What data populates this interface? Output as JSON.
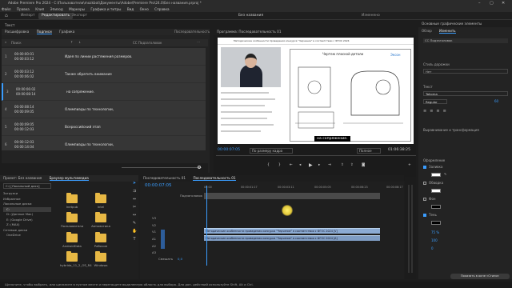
{
  "titlebar": {
    "text": "Adobe Premiere Pro 2024 - C:\\Пользователи\\mozkbot\\Документы\\Adobe\\Premiere Pro\\24.0\\Без названия.prproj *",
    "min": "–",
    "max": "▢",
    "close": "✕"
  },
  "menu": [
    "Файл",
    "Правка",
    "Клип",
    "Эпизод",
    "Маркеры",
    "Графика и титры",
    "Вид",
    "Окно",
    "Справка"
  ],
  "workspace": {
    "home": "⌂",
    "tabs": [
      "Импорт",
      "Редактировать",
      "Экспорт"
    ],
    "active": "Редактировать",
    "center": "Без названия",
    "right": "Изменено"
  },
  "captions_panel": {
    "title": "Текст",
    "tabs": [
      "Расшифровка",
      "Подписи",
      "Графика"
    ],
    "active_tab": "Подписи",
    "sequence": "Последовательность 01",
    "search_placeholder": "Поиск",
    "track_label": "CC Подзаголовок",
    "rows": [
      {
        "num": "1",
        "start": "00:00:00:01",
        "end": "00:00:03:12",
        "text": "Идея по линии растяжения размеров."
      },
      {
        "num": "2",
        "start": "00:00:03:12",
        "end": "00:00:06:02",
        "text": "Также обратить внимание"
      },
      {
        "num": "3",
        "start": "00:00:06:02",
        "end": "00:00:08:14",
        "text": "на сопряжение."
      },
      {
        "num": "4",
        "start": "00:00:08:14",
        "end": "00:00:09:05",
        "text": "Олимпиады по технологии,"
      },
      {
        "num": "5",
        "start": "00:00:09:05",
        "end": "00:00:12:03",
        "text": "Всероссийский этап"
      },
      {
        "num": "6",
        "start": "00:00:12:03",
        "end": "00:00:14:04",
        "text": "Олимпиады по технологии,"
      }
    ]
  },
  "program": {
    "title": "Программа: Последовательность 01",
    "timecode": "00:00:07:05",
    "fit": "По размеру кадра",
    "quality": "Полное",
    "duration": "01:06:38:25",
    "subtitle_overlay": "на сопряжение.",
    "slide_title": "Чертеж плоской детали",
    "webinar_header": "Методические особенности проведения конкурса \"Черчение\" в соответствии с ФГОС 2024",
    "brand": "Эксон"
  },
  "project_panel": {
    "title": "Проект: Без названия",
    "browser_tab": "Браузер мультимедиа",
    "location": "C:\\ [Локальный диск]",
    "tree": [
      "Загрузки",
      "Избранное",
      "Локальные диски",
      "C:",
      "D: (Данные Мак)",
      "E: (Google Drive)",
      "Z: (MAX)",
      "Сетевые диски",
      "OneDrive"
    ],
    "folders": [
      "Inetpub",
      "Intel",
      "Автоматика",
      "Пользователи",
      "PerfLogs",
      "Python",
      "AndroidData",
      "Рабочие",
      "Program Files",
      "Tmp",
      "hybrida_11_2_OS_R4",
      "Windows"
    ]
  },
  "timeline": {
    "tabs": [
      "Последовательность 01",
      "Последовательность 01"
    ],
    "timecode": "00:00:07:05",
    "ruler": [
      "00:00",
      "00:00:01:17",
      "00:00:03:11",
      "00:00:05:05",
      "00:00:06:23",
      "00:00:08:17"
    ],
    "subtitle_track": "Подзаголовок",
    "tracks": [
      "V3",
      "V2",
      "V1",
      "A1",
      "A2",
      "A3"
    ],
    "mix": "Смешать",
    "mix_value": "0,0",
    "clip_v1": "Методические особенности проведения конкурса \"Черчение\" в соответствии с ФГОС 2024 [V]",
    "clip_a1": "Методические особенности проведения конкурса \"Черчение\" в соответствии с ФГОС 2024 [A]"
  },
  "essential_graphics": {
    "title": "Основные графические элементы",
    "tabs": [
      "Обзор",
      "Изменить"
    ],
    "active_tab": "Изменить",
    "track_style": "Стиль дорожки",
    "track_style_value": "Нет",
    "style_label": "Стиль дорожки",
    "font": "Tahoma",
    "weight": "Regular",
    "size": "60",
    "text_section": "Текст",
    "appearance": "Оформление",
    "fill": "Заливка",
    "stroke": "Обводка",
    "background": "Фон",
    "shadow": "Тень",
    "bg_value": "100",
    "bg_opacity": "75 %",
    "shadow_value": "0",
    "align_label": "Выравнивание и трансформация",
    "bottom_button": "Показать в окне «Стили»"
  },
  "status": "Щелкните, чтобы выбрать, или щелкните в пустом месте и перетащите выделенную область для выбора. Для доп. действий используйте Shift, Alt и Ctrl."
}
